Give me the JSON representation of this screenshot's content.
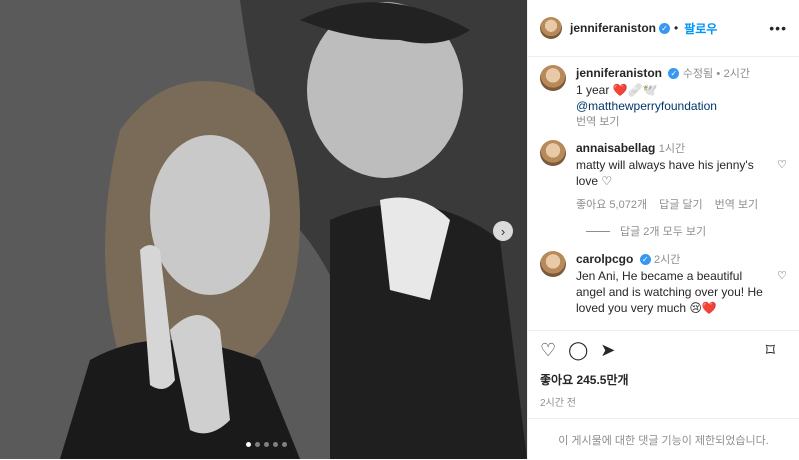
{
  "post": {
    "image_description_icon": "photo-black-and-white",
    "carousel": {
      "count": 5,
      "active_index": 0,
      "next_icon": "chevron-right-icon"
    }
  },
  "header": {
    "username": "jenniferaniston",
    "follow_label": "팔로우",
    "separator": "•",
    "more_icon": "more-horizontal-icon"
  },
  "caption": {
    "username": "jenniferaniston",
    "edited_label": "수정됨",
    "dot": "•",
    "time": "2시간",
    "text": "1 year",
    "emojis": "❤️🩹🕊️",
    "mention": "@matthewperryfoundation",
    "translate_label": "번역 보기"
  },
  "comments": [
    {
      "username": "annaisabellag",
      "time": "1시간",
      "text": "matty will always have his jenny's love",
      "text_emoji": "♡",
      "likes_label": "좋아요 5,072개",
      "reply_label": "답글 달기",
      "translate_label": "번역 보기",
      "view_replies_label": "답글 2개 모두 보기"
    },
    {
      "username": "carolpcgo",
      "time": "2시간",
      "text": "Jen Ani, He became a beautiful angel and is watching over you! He loved you very much",
      "text_emoji": "😢❤️"
    }
  ],
  "footer": {
    "likes_label": "좋아요 245.5만개",
    "time_label": "2시간 전",
    "comments_disabled_label": "이 게시물에 대한 댓글 기능이 제한되었습니다."
  },
  "colors": {
    "link": "#00376b",
    "follow": "#0095f6",
    "verified": "#3897f0",
    "heart": "#ed4956"
  }
}
